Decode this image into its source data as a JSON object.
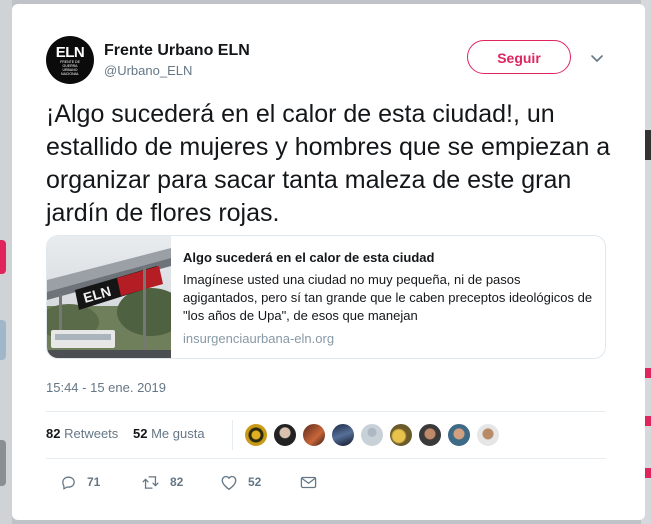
{
  "account": {
    "name": "Frente Urbano ELN",
    "handle": "@Urbano_ELN",
    "avatar_logo": "ELN",
    "avatar_subtitle": "FRENTE DE GUERRA URBANO NACIONAL"
  },
  "follow_button": {
    "label": "Seguir",
    "color": "#e0245e"
  },
  "menu": {
    "icon": "chevron-down-icon"
  },
  "tweet": {
    "text": "¡Algo sucederá en el calor de esta ciudad!, un estallido de mujeres y hombres que se empiezan a organizar para sacar tanta maleza de este gran jardín de flores rojas."
  },
  "link_card": {
    "title": "Algo sucederá en el calor de esta ciudad",
    "description": "Imagínese usted una ciudad no muy pequeña, ni de pasos agigantados, pero sí tan grande que le caben preceptos ideológicos de \"los años de Upa\", de esos que manejan",
    "domain": "insurgenciaurbana-eln.org",
    "image": "banner-on-pedestrian-bridge"
  },
  "timestamp": "15:44 - 15 ene. 2019",
  "stats": {
    "retweets_count": "82",
    "retweets_label": "Retweets",
    "likes_count": "52",
    "likes_label": "Me gusta"
  },
  "actions": {
    "reply": {
      "icon": "reply-icon",
      "count": "71"
    },
    "retweet": {
      "icon": "retweet-icon",
      "count": "82"
    },
    "like": {
      "icon": "heart-icon",
      "count": "52"
    },
    "message": {
      "icon": "envelope-icon"
    }
  },
  "colors": {
    "text_primary": "#14171a",
    "text_secondary": "#657786",
    "border": "#e6ecf0",
    "accent": "#e0245e"
  }
}
